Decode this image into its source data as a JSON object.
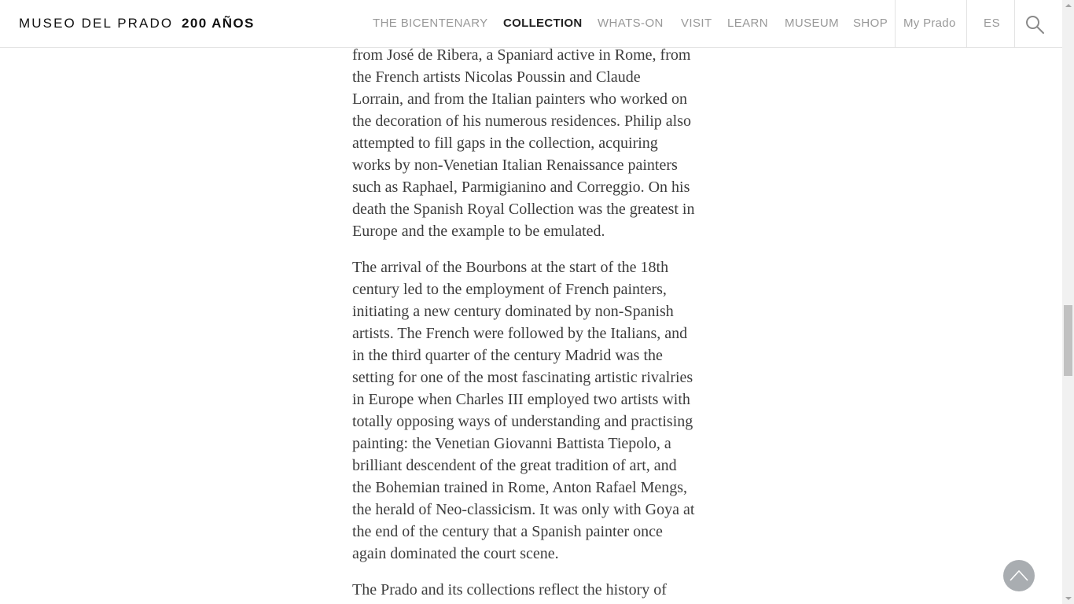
{
  "header": {
    "logo_text": "MUSEO DEL PRADO",
    "logo_bold": "200 AÑOS",
    "nav": [
      {
        "label": "THE BICENTENARY",
        "active": false
      },
      {
        "label": "COLLECTION",
        "active": true
      },
      {
        "label": "WHATS-ON",
        "active": false
      },
      {
        "label": "VISIT",
        "active": false
      },
      {
        "label": "LEARN",
        "active": false
      },
      {
        "label": "MUSEUM",
        "active": false
      },
      {
        "label": "SHOP",
        "active": false
      }
    ],
    "my_prado": "My Prado",
    "language": "ES",
    "search_icon": "search-icon"
  },
  "article": {
    "paragraphs": [
      [
        "from José de Ribera, a Spaniard active in Rome, from",
        "the French artists Nicolas Poussin and Claude",
        "Lorrain, and from the Italian painters who worked on",
        "the decoration of his numerous residences. Philip also",
        "attempted to fill gaps in the collection, acquiring",
        "works by non-Venetian Italian Renaissance painters",
        "such as Raphael, Parmigianino and Correggio. On his",
        "death the Spanish Royal Collection was the greatest in",
        "Europe and the example to be emulated."
      ],
      [
        "The arrival of the Bourbons at the start of the 18th",
        "century led to the employment of French painters,",
        "initiating a new century dominated by non-Spanish",
        "artists. The French were followed by the Italians, and",
        "in the third quarter of the century Madrid was the",
        "setting for one of the most fascinating artistic rivalries",
        "in Europe when Charles III employed two artists with",
        "totally opposing ways of understanding and practising",
        "painting: the Venetian Giovanni Battista Tiepolo, a",
        "brilliant descendent of the great tradition of art, and",
        "the Bohemian trained in Rome, Anton Rafael Mengs,",
        "the herald of Neo-classicism. It was only with Goya at",
        "the end of the century that a Spanish painter once",
        "again dominated the court scene."
      ],
      [
        "The Prado and its collections reflect the history of"
      ]
    ]
  },
  "controls": {
    "back_to_top_icon": "chevron-up-icon"
  }
}
